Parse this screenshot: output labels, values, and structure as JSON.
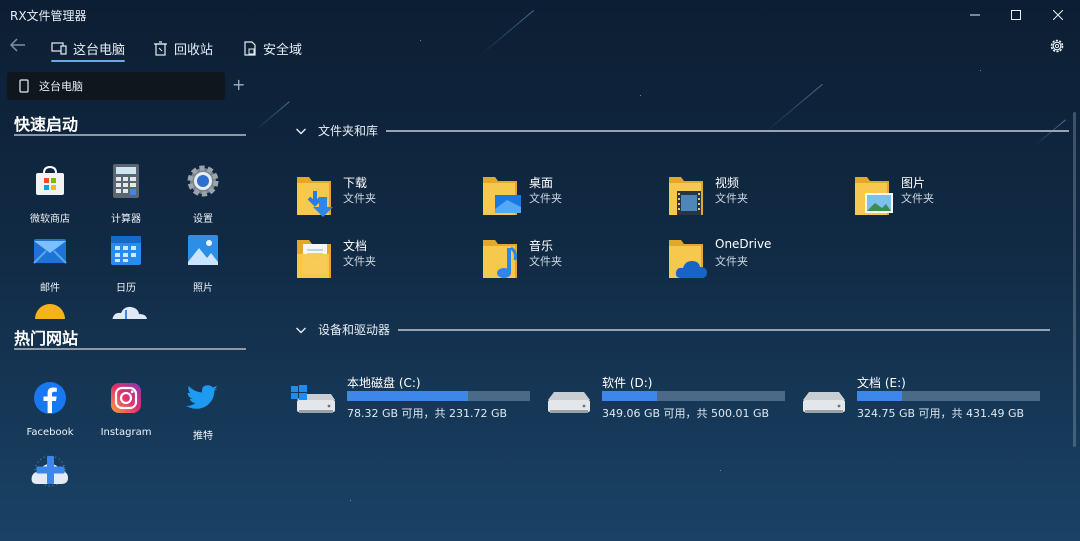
{
  "window": {
    "title": "RX文件管理器",
    "controls": [
      "minimize",
      "maximize",
      "close"
    ]
  },
  "nav": {
    "tabs": [
      {
        "label": "这台电脑",
        "icon": "computer-icon",
        "active": true
      },
      {
        "label": "回收站",
        "icon": "recycle-bin-icon",
        "active": false
      },
      {
        "label": "安全域",
        "icon": "secure-area-icon",
        "active": false
      }
    ]
  },
  "pathbar": {
    "label": "这台电脑",
    "add": "+"
  },
  "sidebar": {
    "quick_launch": {
      "title": "快速启动",
      "items": [
        {
          "label": "微软商店",
          "icon": "store-icon"
        },
        {
          "label": "计算器",
          "icon": "calculator-icon"
        },
        {
          "label": "设置",
          "icon": "settings-gear-icon"
        },
        {
          "label": "邮件",
          "icon": "mail-icon"
        },
        {
          "label": "日历",
          "icon": "calendar-icon"
        },
        {
          "label": "照片",
          "icon": "photos-icon"
        }
      ]
    },
    "hot_sites": {
      "title": "热门网站",
      "items": [
        {
          "label": "Facebook",
          "icon": "facebook-icon"
        },
        {
          "label": "Instagram",
          "icon": "instagram-icon"
        },
        {
          "label": "推特",
          "icon": "twitter-icon"
        }
      ]
    }
  },
  "main": {
    "folders_section": {
      "title": "文件夹和库",
      "items": [
        {
          "name": "下载",
          "type": "文件夹",
          "icon": "downloads-folder-icon"
        },
        {
          "name": "桌面",
          "type": "文件夹",
          "icon": "desktop-folder-icon"
        },
        {
          "name": "视频",
          "type": "文件夹",
          "icon": "videos-folder-icon"
        },
        {
          "name": "图片",
          "type": "文件夹",
          "icon": "pictures-folder-icon"
        },
        {
          "name": "文档",
          "type": "文件夹",
          "icon": "documents-folder-icon"
        },
        {
          "name": "音乐",
          "type": "文件夹",
          "icon": "music-folder-icon"
        },
        {
          "name": "OneDrive",
          "type": "文件夹",
          "icon": "onedrive-folder-icon"
        }
      ]
    },
    "drives_section": {
      "title": "设备和驱动器",
      "items": [
        {
          "name": "本地磁盘 (C:)",
          "info": "78.32 GB 可用，共 231.72 GB",
          "used_fraction": 0.662,
          "icon": "system-drive-icon"
        },
        {
          "name": "软件 (D:)",
          "info": "349.06 GB 可用，共 500.01 GB",
          "used_fraction": 0.302,
          "icon": "drive-icon"
        },
        {
          "name": "文档 (E:)",
          "info": "324.75 GB 可用，共 431.49 GB",
          "used_fraction": 0.247,
          "icon": "drive-icon"
        }
      ]
    }
  },
  "colors": {
    "accent": "#3d86ea",
    "bar_track": "#4a6a87",
    "folder_yellow": "#f6c94e"
  }
}
